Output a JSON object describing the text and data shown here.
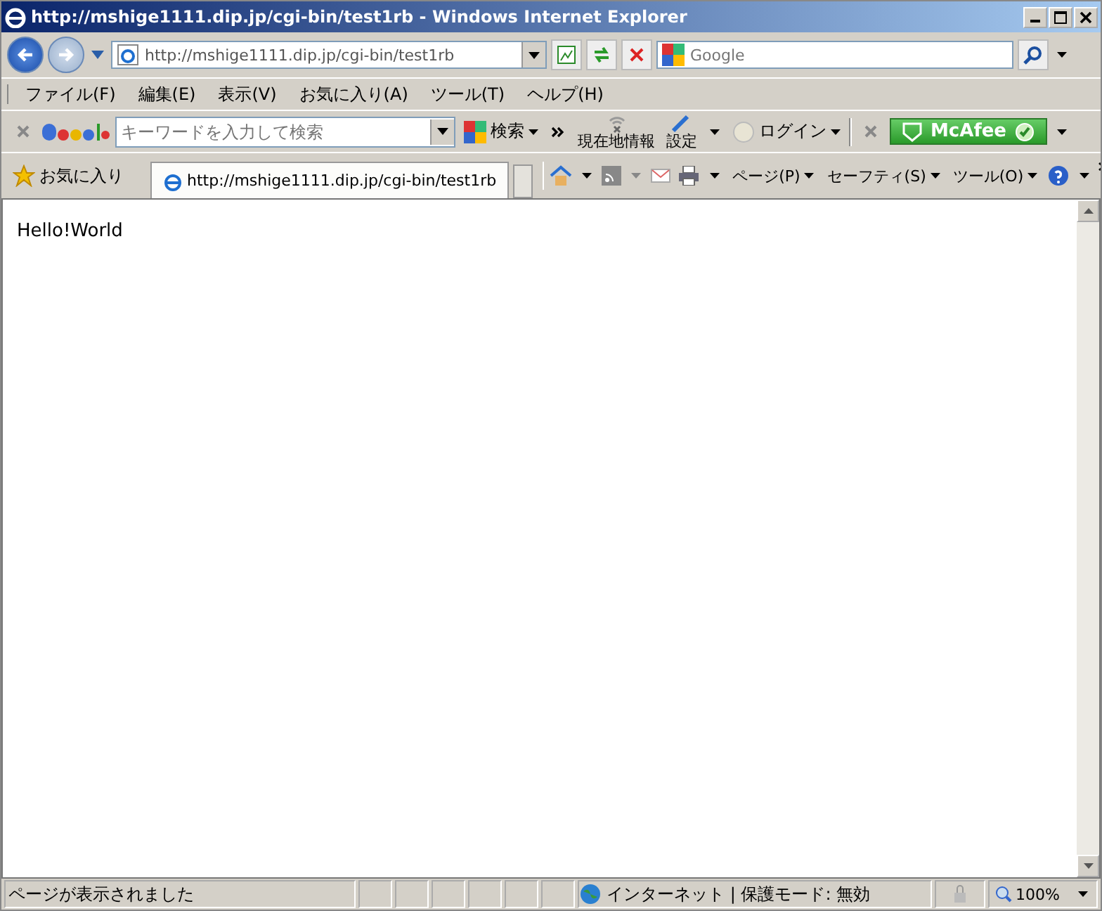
{
  "window": {
    "title": "http://mshige1111.dip.jp/cgi-bin/test1rb - Windows Internet Explorer"
  },
  "address_bar": {
    "value": "http://mshige1111.dip.jp/cgi-bin/test1rb"
  },
  "search_box": {
    "placeholder": "Google"
  },
  "menu": [
    "ファイル(F)",
    "編集(E)",
    "表示(V)",
    "お気に入り(A)",
    "ツール(T)",
    "ヘルプ(H)"
  ],
  "google_toolbar": {
    "placeholder": "キーワードを入力して検索",
    "search_label": "検索",
    "location_label": "現在地情報",
    "settings_label": "設定",
    "login_label": "ログイン",
    "mcafee_label": "McAfee"
  },
  "favorites": {
    "label": "お気に入り"
  },
  "tabs": [
    {
      "label": "http://mshige1111.dip.jp/cgi-bin/test1rb",
      "selected": true
    }
  ],
  "command_bar": [
    "ページ(P)",
    "セーフティ(S)",
    "ツール(O)"
  ],
  "page": {
    "text": "Hello!World"
  },
  "status_bar": {
    "message": "ページが表示されました",
    "zone": "インターネット | 保護モード: 無効",
    "zoom": "100%"
  }
}
